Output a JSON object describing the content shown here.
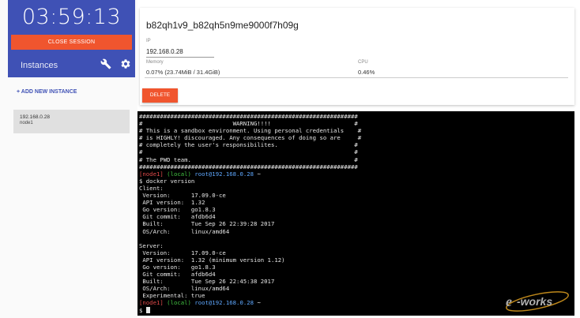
{
  "sidebar": {
    "timer": "03:59:13",
    "close_session_label": "CLOSE SESSION",
    "instances_label": "Instances",
    "wrench_icon": "wrench-icon",
    "gear_icon": "gear-icon",
    "add_instance_label": "+ ADD NEW INSTANCE",
    "instances": [
      {
        "ip": "192.168.0.28",
        "name": "node1"
      }
    ]
  },
  "info": {
    "session_id": "b82qh1v9_b82qh5n9me9000f7h09g",
    "ip_label": "IP",
    "ip_value": "192.168.0.28",
    "memory_label": "Memory",
    "memory_value": "0.07% (23.74MiB / 31.4GiB)",
    "cpu_label": "CPU",
    "cpu_value": "0.46%",
    "delete_label": "DELETE"
  },
  "terminal": {
    "banner": [
      "###############################################################",
      "#                          WARNING!!!!                        #",
      "# This is a sandbox environment. Using personal credentials    #",
      "# is HIGHLY! discouraged. Any consequences of doing so are     #",
      "# completely the user's responsibilites.                      #",
      "#                                                             #",
      "# The PWD team.                                               #",
      "###############################################################"
    ],
    "prompt_node": "[node1]",
    "prompt_local": "(local)",
    "prompt_user": "root@192.168.0.28",
    "prompt_dir": "~",
    "command": "$ docker version",
    "output": [
      "Client:",
      " Version:      17.09.0-ce",
      " API version:  1.32",
      " Go version:   go1.8.3",
      " Git commit:   afdb6d4",
      " Built:        Tue Sep 26 22:39:28 2017",
      " OS/Arch:      linux/amd64",
      "",
      "Server:",
      " Version:      17.09.0-ce",
      " API version:  1.32 (minimum version 1.12)",
      " Go version:   go1.8.3",
      " Git commit:   afdb6d4",
      " Built:        Tue Sep 26 22:45:38 2017",
      " OS/Arch:      linux/amd64",
      " Experimental: true"
    ],
    "final_prompt_symbol": "$"
  },
  "watermark": {
    "text": "e-works"
  },
  "colors": {
    "primary": "#3f51b5",
    "accent": "#f0552e",
    "terminal_bg": "#000000",
    "prompt_node": "#e04a4a",
    "prompt_local": "#42c442",
    "prompt_user": "#5fa8ff"
  }
}
